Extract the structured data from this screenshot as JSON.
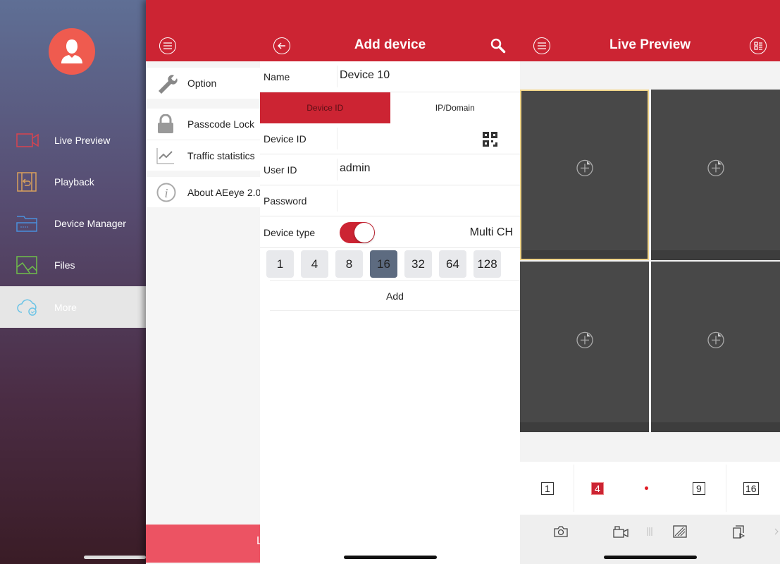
{
  "sidebar": {
    "items": [
      {
        "label": "Live Preview",
        "icon": "video-camera-icon",
        "color": "#d9434f"
      },
      {
        "label": "Playback",
        "icon": "film-playback-icon",
        "color": "#d9a05c"
      },
      {
        "label": "Device Manager",
        "icon": "device-folder-icon",
        "color": "#4a8fdc"
      },
      {
        "label": "Files",
        "icon": "image-icon",
        "color": "#6fbf4a"
      },
      {
        "label": "More",
        "icon": "cloud-check-icon",
        "color": "#6cc4e6",
        "selected": true
      }
    ]
  },
  "more": {
    "items": [
      {
        "label": "Option",
        "icon": "wrench-icon"
      },
      {
        "label": "Passcode Lock",
        "icon": "lock-icon"
      },
      {
        "label": "Traffic statistics",
        "icon": "chart-icon"
      },
      {
        "label": "About AEeye 2.0",
        "icon": "info-icon"
      }
    ],
    "bottom_button": "L"
  },
  "add_device": {
    "title": "Add device",
    "name_label": "Name",
    "name_value": "Device 10",
    "tabs": [
      {
        "label": "Device ID",
        "active": true
      },
      {
        "label": "IP/Domain",
        "active": false
      }
    ],
    "device_id_label": "Device ID",
    "device_id_value": "",
    "user_id_label": "User ID",
    "user_id_value": "admin",
    "password_label": "Password",
    "password_value": "",
    "device_type_label": "Device type",
    "device_type_toggle": true,
    "device_type_value": "Multi CH",
    "channels": [
      "1",
      "4",
      "8",
      "16",
      "32",
      "64",
      "128"
    ],
    "selected_channel": "16",
    "add_label": "Add"
  },
  "live": {
    "title": "Live Preview",
    "layouts": [
      "1",
      "4",
      "9",
      "16"
    ],
    "selected_layout": "4"
  },
  "colors": {
    "accent": "#cc2433",
    "selected_cell": "#f2d68a"
  }
}
